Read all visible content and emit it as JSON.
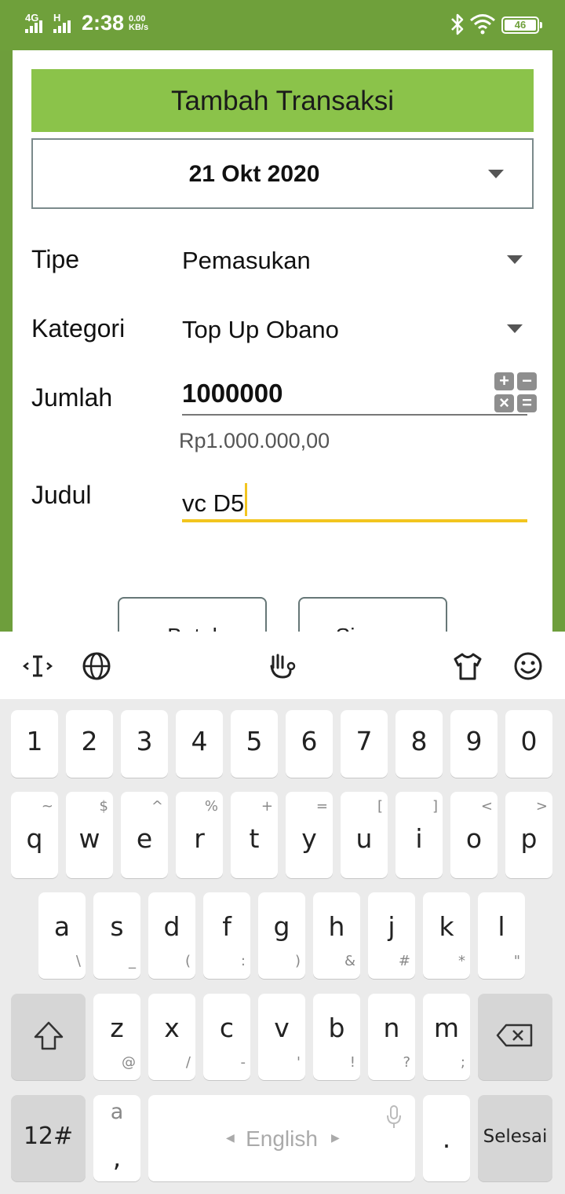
{
  "status_bar": {
    "network": "4G",
    "network2": "H",
    "time": "2:38",
    "speed_value": "0.00",
    "speed_unit": "KB/s",
    "battery": "46"
  },
  "dialog": {
    "title": "Tambah Transaksi",
    "date": "21 Okt 2020",
    "type_label": "Tipe",
    "type_value": "Pemasukan",
    "category_label": "Kategori",
    "category_value": "Top Up Obano",
    "amount_label": "Jumlah",
    "amount_value": "1000000",
    "amount_formatted": "Rp1.000.000,00",
    "title_label": "Judul",
    "title_value": "vc D5",
    "calc_symbols": [
      "+",
      "−",
      "×",
      "="
    ],
    "cancel_label": "Batal",
    "save_label": "Simpan"
  },
  "keyboard": {
    "number_row": [
      "1",
      "2",
      "3",
      "4",
      "5",
      "6",
      "7",
      "8",
      "9",
      "0"
    ],
    "row1": [
      {
        "k": "q",
        "a": "~"
      },
      {
        "k": "w",
        "a": "$"
      },
      {
        "k": "e",
        "a": "^"
      },
      {
        "k": "r",
        "a": "%"
      },
      {
        "k": "t",
        "a": "+"
      },
      {
        "k": "y",
        "a": "="
      },
      {
        "k": "u",
        "a": "["
      },
      {
        "k": "i",
        "a": "]"
      },
      {
        "k": "o",
        "a": "<"
      },
      {
        "k": "p",
        "a": ">"
      }
    ],
    "row2": [
      {
        "k": "a",
        "a": "\\"
      },
      {
        "k": "s",
        "a": "_"
      },
      {
        "k": "d",
        "a": "("
      },
      {
        "k": "f",
        "a": ":"
      },
      {
        "k": "g",
        "a": ")"
      },
      {
        "k": "h",
        "a": "&"
      },
      {
        "k": "j",
        "a": "#"
      },
      {
        "k": "k",
        "a": "*"
      },
      {
        "k": "l",
        "a": "\""
      }
    ],
    "row3": [
      {
        "k": "z",
        "a": "@"
      },
      {
        "k": "x",
        "a": "/"
      },
      {
        "k": "c",
        "a": "-"
      },
      {
        "k": "v",
        "a": "'"
      },
      {
        "k": "b",
        "a": "!"
      },
      {
        "k": "n",
        "a": "?"
      },
      {
        "k": "m",
        "a": ";"
      }
    ],
    "symbols_label": "12#",
    "comma_top": "a",
    "comma_bottom": ",",
    "space_label": "English",
    "period_label": ".",
    "done_label": "Selesai"
  }
}
